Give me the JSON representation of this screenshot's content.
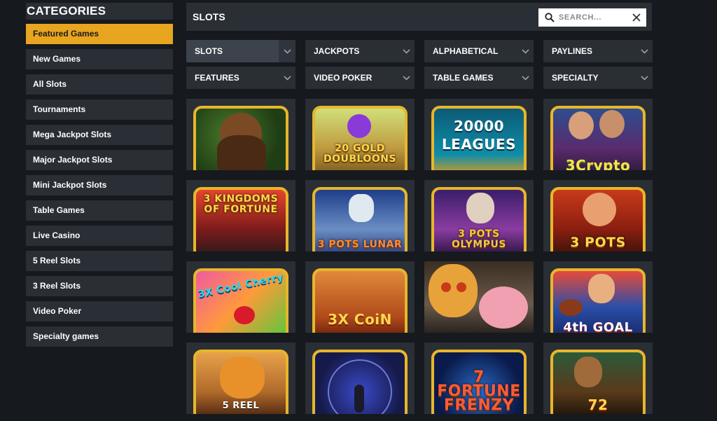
{
  "sidebar": {
    "title": "CATEGORIES",
    "items": [
      {
        "label": "Featured Games",
        "active": true
      },
      {
        "label": "New Games"
      },
      {
        "label": "All Slots"
      },
      {
        "label": "Tournaments"
      },
      {
        "label": "Mega Jackpot Slots"
      },
      {
        "label": "Major Jackpot Slots"
      },
      {
        "label": "Mini Jackpot Slots"
      },
      {
        "label": "Table Games"
      },
      {
        "label": "Live Casino"
      },
      {
        "label": "5 Reel Slots"
      },
      {
        "label": "3 Reel Slots"
      },
      {
        "label": "Video Poker"
      },
      {
        "label": "Specialty games"
      }
    ]
  },
  "header": {
    "title": "SLOTS",
    "search_placeholder": "SEARCH..."
  },
  "filters": [
    {
      "label": "SLOTS",
      "active": true
    },
    {
      "label": "JACKPOTS"
    },
    {
      "label": "ALPHABETICAL"
    },
    {
      "label": "PAYLINES"
    },
    {
      "label": "FEATURES"
    },
    {
      "label": "VIDEO POKER"
    },
    {
      "label": "TABLE GAMES"
    },
    {
      "label": "SPECIALTY"
    }
  ],
  "games": [
    {
      "name": "caveman-thumbs-up",
      "label": ""
    },
    {
      "name": "20-gold-doubloons",
      "label": "20 GOLD DOUBLOONS"
    },
    {
      "name": "20000-leagues",
      "label": "20000 LEAGUES"
    },
    {
      "name": "3-crypto",
      "label": "3Crypto"
    },
    {
      "name": "3-kingdoms-of-fortune",
      "label": "3 KINGDOMS OF FORTUNE"
    },
    {
      "name": "3-pots-of-lunar",
      "label": "3 POTS LUNAR"
    },
    {
      "name": "3-pots-of-olympus",
      "label": "3 POTS OLYMPUS"
    },
    {
      "name": "3-pots",
      "label": "3 POTS"
    },
    {
      "name": "3x-cool-cherry",
      "label": "3X Cool Cherry"
    },
    {
      "name": "3x-coin",
      "label": "3X CoiN"
    },
    {
      "name": "cat-and-pig",
      "label": ""
    },
    {
      "name": "4th-goal",
      "label": "4th GOAL"
    },
    {
      "name": "5-reel-tiger",
      "label": "5 REEL"
    },
    {
      "name": "orb-portal",
      "label": ""
    },
    {
      "name": "7-fortune-frenzy",
      "label": "7 FORTUNE FRENZY"
    },
    {
      "name": "72-monkey",
      "label": "72"
    }
  ],
  "colors": {
    "accent": "#e7a520",
    "panel": "#2a2e35",
    "background": "#16191d",
    "frame": "#e8b62a"
  }
}
